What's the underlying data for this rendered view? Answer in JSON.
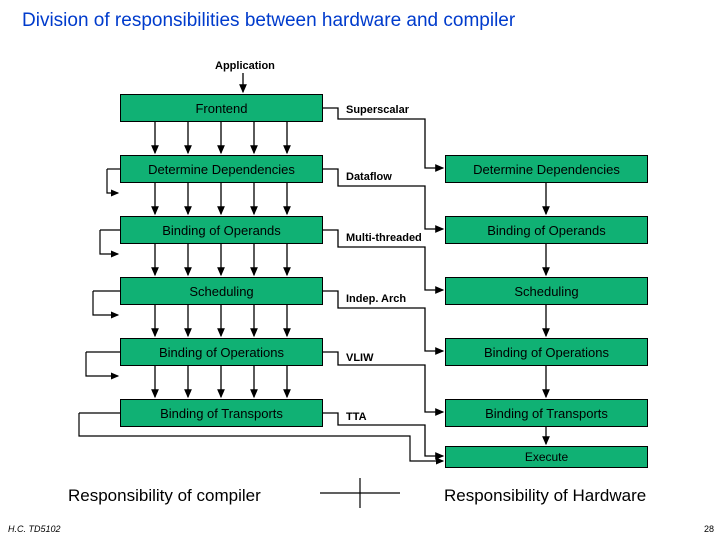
{
  "title": "Division of responsibilities between hardware and compiler",
  "app_label": "Application",
  "left": {
    "frontend": "Frontend",
    "deps": "Determine Dependencies",
    "operands": "Binding of Operands",
    "sched": "Scheduling",
    "ops": "Binding of Operations",
    "trans": "Binding of Transports"
  },
  "right": {
    "deps": "Determine Dependencies",
    "operands": "Binding of Operands",
    "sched": "Scheduling",
    "ops": "Binding of Operations",
    "trans": "Binding of Transports",
    "exec": "Execute"
  },
  "arch": {
    "superscalar": "Superscalar",
    "dataflow": "Dataflow",
    "multithreaded": "Multi-threaded",
    "indep": "Indep. Arch",
    "vliw": "VLIW",
    "tta": "TTA"
  },
  "footer": {
    "compiler": "Responsibility of compiler",
    "hardware": "Responsibility of Hardware"
  },
  "credit": "H.C.  TD5102",
  "pagenum": "28"
}
